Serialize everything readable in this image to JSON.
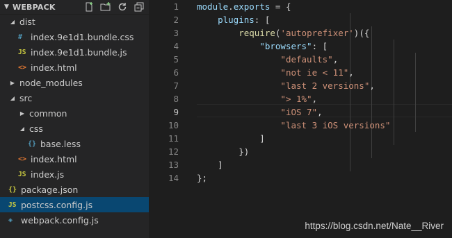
{
  "explorer": {
    "title": "WEBPACK",
    "actions": [
      "new-file-icon",
      "new-folder-icon",
      "refresh-icon",
      "collapse-all-icon"
    ],
    "items": [
      {
        "label": "dist",
        "type": "folder",
        "expanded": true,
        "depth": 0,
        "icon": "chevron-down-icon"
      },
      {
        "label": "index.9e1d1.bundle.css",
        "type": "css",
        "depth": 1,
        "icon_text": "#"
      },
      {
        "label": "index.9e1d1.bundle.js",
        "type": "js",
        "depth": 1,
        "icon_text": "JS"
      },
      {
        "label": "index.html",
        "type": "html",
        "depth": 1,
        "icon_text": "<>"
      },
      {
        "label": "node_modules",
        "type": "folder",
        "expanded": false,
        "depth": 0
      },
      {
        "label": "src",
        "type": "folder",
        "expanded": true,
        "depth": 0
      },
      {
        "label": "common",
        "type": "folder",
        "expanded": false,
        "depth": 1
      },
      {
        "label": "css",
        "type": "folder",
        "expanded": true,
        "depth": 1
      },
      {
        "label": "base.less",
        "type": "less",
        "depth": 2,
        "icon_text": "{}"
      },
      {
        "label": "index.html",
        "type": "html",
        "depth": 1,
        "icon_text": "<>"
      },
      {
        "label": "index.js",
        "type": "js",
        "depth": 1,
        "icon_text": "JS"
      },
      {
        "label": "package.json",
        "type": "json",
        "depth": 0,
        "icon_text": "{}"
      },
      {
        "label": "postcss.config.js",
        "type": "js",
        "depth": 0,
        "icon_text": "JS",
        "selected": true
      },
      {
        "label": "webpack.config.js",
        "type": "webpack",
        "depth": 0,
        "icon_text": "◈"
      }
    ]
  },
  "editor": {
    "active_line": "9",
    "lines": [
      {
        "n": "1",
        "tokens": [
          {
            "t": "module",
            "c": "var"
          },
          {
            "t": ".",
            "c": "p"
          },
          {
            "t": "exports",
            "c": "prop"
          },
          {
            "t": " = {",
            "c": "p"
          }
        ]
      },
      {
        "n": "2",
        "tokens": [
          {
            "t": "    plugins",
            "c": "prop"
          },
          {
            "t": ": [",
            "c": "p"
          }
        ]
      },
      {
        "n": "3",
        "tokens": [
          {
            "t": "        ",
            "c": "p"
          },
          {
            "t": "require",
            "c": "fn"
          },
          {
            "t": "(",
            "c": "p"
          },
          {
            "t": "'autoprefixer'",
            "c": "str"
          },
          {
            "t": ")({",
            "c": "p"
          }
        ]
      },
      {
        "n": "4",
        "tokens": [
          {
            "t": "            ",
            "c": "p"
          },
          {
            "t": "\"browsers\"",
            "c": "prop"
          },
          {
            "t": ": [",
            "c": "p"
          }
        ]
      },
      {
        "n": "5",
        "tokens": [
          {
            "t": "                ",
            "c": "p"
          },
          {
            "t": "\"defaults\"",
            "c": "str"
          },
          {
            "t": ",",
            "c": "p"
          }
        ]
      },
      {
        "n": "6",
        "tokens": [
          {
            "t": "                ",
            "c": "p"
          },
          {
            "t": "\"not ie < 11\"",
            "c": "str"
          },
          {
            "t": ",",
            "c": "p"
          }
        ]
      },
      {
        "n": "7",
        "tokens": [
          {
            "t": "                ",
            "c": "p"
          },
          {
            "t": "\"last 2 versions\"",
            "c": "str"
          },
          {
            "t": ",",
            "c": "p"
          }
        ]
      },
      {
        "n": "8",
        "tokens": [
          {
            "t": "                ",
            "c": "p"
          },
          {
            "t": "\"> 1%\"",
            "c": "str"
          },
          {
            "t": ",",
            "c": "p"
          }
        ]
      },
      {
        "n": "9",
        "tokens": [
          {
            "t": "                ",
            "c": "p"
          },
          {
            "t": "\"iOS 7\"",
            "c": "str"
          },
          {
            "t": ",",
            "c": "p"
          }
        ]
      },
      {
        "n": "10",
        "tokens": [
          {
            "t": "                ",
            "c": "p"
          },
          {
            "t": "\"last 3 iOS versions\"",
            "c": "str"
          }
        ]
      },
      {
        "n": "11",
        "tokens": [
          {
            "t": "            ]",
            "c": "p"
          }
        ]
      },
      {
        "n": "12",
        "tokens": [
          {
            "t": "        })",
            "c": "p"
          }
        ]
      },
      {
        "n": "13",
        "tokens": [
          {
            "t": "    ]",
            "c": "p"
          }
        ]
      },
      {
        "n": "14",
        "tokens": [
          {
            "t": "};",
            "c": "p"
          }
        ]
      }
    ]
  },
  "watermark": "https://blog.csdn.net/Nate__River",
  "colors": {
    "selected_row": "#094771",
    "sidebar_bg": "#252526",
    "editor_bg": "#1e1e1e",
    "string": "#ce9178",
    "property": "#9cdcfe",
    "function": "#dcdcaa"
  }
}
